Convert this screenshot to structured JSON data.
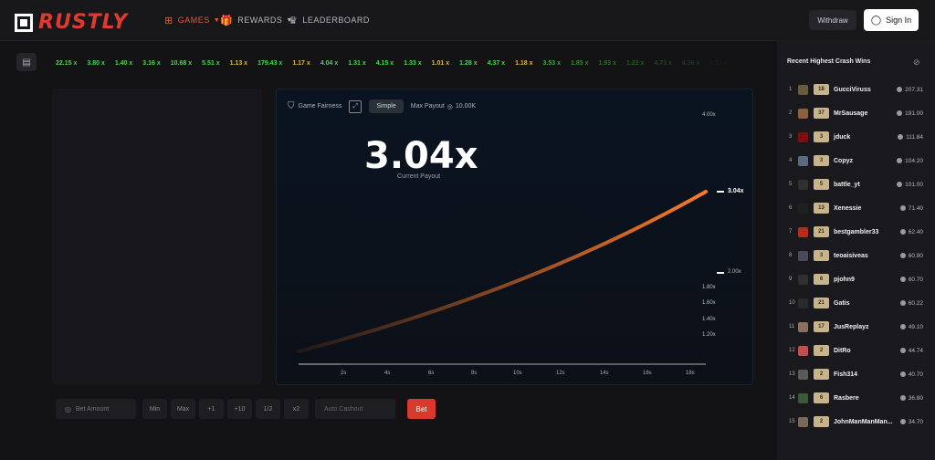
{
  "header": {
    "logo_text": "RUSTLY",
    "nav": [
      {
        "label": "GAMES",
        "icon": "grid-icon"
      },
      {
        "label": "REWARDS",
        "icon": "gift-icon"
      },
      {
        "label": "LEADERBOARD",
        "icon": "crown-icon"
      }
    ],
    "withdraw_label": "Withdraw",
    "signin_label": "Sign In"
  },
  "history": [
    {
      "value": "22.15 x",
      "color": "#4bd64b"
    },
    {
      "value": "3.80 x",
      "color": "#4bd64b"
    },
    {
      "value": "1.40 x",
      "color": "#4bd64b"
    },
    {
      "value": "3.16 x",
      "color": "#4bd64b"
    },
    {
      "value": "10.68 x",
      "color": "#4bd64b"
    },
    {
      "value": "5.51 x",
      "color": "#4bd64b"
    },
    {
      "value": "1.13 x",
      "color": "#e0b83a"
    },
    {
      "value": "179.43 x",
      "color": "#4bd64b"
    },
    {
      "value": "1.17 x",
      "color": "#e0b83a"
    },
    {
      "value": "4.04 x",
      "color": "#4bd64b"
    },
    {
      "value": "1.31 x",
      "color": "#4bd64b"
    },
    {
      "value": "4.15 x",
      "color": "#4bd64b"
    },
    {
      "value": "1.33 x",
      "color": "#4bd64b"
    },
    {
      "value": "1.01 x",
      "color": "#e0b83a"
    },
    {
      "value": "1.28 x",
      "color": "#4bd64b"
    },
    {
      "value": "4.37 x",
      "color": "#4bd64b"
    },
    {
      "value": "1.18 x",
      "color": "#e0b83a"
    },
    {
      "value": "3.53 x",
      "color": "#3fa83f"
    },
    {
      "value": "1.85 x",
      "color": "#2f8a2f"
    },
    {
      "value": "1.93 x",
      "color": "#277027"
    },
    {
      "value": "1.22 x",
      "color": "#1f5a1f"
    },
    {
      "value": "4.73 x",
      "color": "#1a4a1a"
    },
    {
      "value": "4.36 x",
      "color": "#163c16"
    },
    {
      "value": "1.13 x",
      "color": "#1a1f12"
    }
  ],
  "game": {
    "fairness_label": "Game Fairness",
    "simple_label": "Simple",
    "max_payout_label": "Max Payout",
    "max_payout_value": "10.00K",
    "current_payout": "3.04x",
    "current_payout_label": "Current Payout",
    "y_ticks": [
      "4.00x",
      "2.00x",
      "1.80x",
      "1.60x",
      "1.40x",
      "1.20x"
    ],
    "y_current": "3.04x",
    "x_ticks": [
      "2s",
      "4s",
      "6s",
      "8s",
      "10s",
      "12s",
      "14s",
      "16s",
      "18s"
    ]
  },
  "controls": {
    "bet_amount_placeholder": "Bet Amount",
    "min_label": "Min",
    "max_label": "Max",
    "plus1_label": "+1",
    "plus10_label": "+10",
    "half_label": "1/2",
    "double_label": "x2",
    "auto_cashout_placeholder": "Auto Cashout",
    "bet_label": "Bet"
  },
  "leaderboard": {
    "title": "Recent Highest Crash Wins",
    "rows": [
      {
        "rank": "1",
        "level": "18",
        "name": "GucciViruss",
        "amount": "207.31"
      },
      {
        "rank": "2",
        "level": "37",
        "name": "MrSausage",
        "amount": "191.00"
      },
      {
        "rank": "3",
        "level": "3",
        "name": "jduck",
        "amount": "111.84"
      },
      {
        "rank": "4",
        "level": "3",
        "name": "Copyz",
        "amount": "104.20"
      },
      {
        "rank": "5",
        "level": "5",
        "name": "battle_yt",
        "amount": "101.00"
      },
      {
        "rank": "6",
        "level": "13",
        "name": "Xenessie",
        "amount": "71.40"
      },
      {
        "rank": "7",
        "level": "21",
        "name": "bestgambler33",
        "amount": "62.40"
      },
      {
        "rank": "8",
        "level": "3",
        "name": "teoaisiveas",
        "amount": "60.90"
      },
      {
        "rank": "9",
        "level": "6",
        "name": "pjohn9",
        "amount": "60.70"
      },
      {
        "rank": "10",
        "level": "21",
        "name": "Gatis",
        "amount": "60.22"
      },
      {
        "rank": "11",
        "level": "17",
        "name": "JusReplayz",
        "amount": "49.10"
      },
      {
        "rank": "12",
        "level": "2",
        "name": "DitRo",
        "amount": "44.74"
      },
      {
        "rank": "13",
        "level": "2",
        "name": "Fish314",
        "amount": "40.70"
      },
      {
        "rank": "14",
        "level": "6",
        "name": "Rasbere",
        "amount": "36.80"
      },
      {
        "rank": "15",
        "level": "2",
        "name": "JohnManManMan...",
        "amount": "34.70"
      }
    ]
  }
}
